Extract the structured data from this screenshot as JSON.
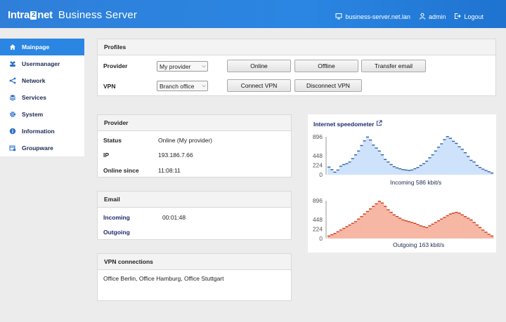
{
  "header": {
    "brand_left": "Intra",
    "brand_box": "2",
    "brand_right": "net",
    "product": "Business Server",
    "host": "business-server.net.lan",
    "user": "admin",
    "logout": "Logout"
  },
  "sidebar": {
    "items": [
      {
        "label": "Mainpage",
        "icon": "home-icon"
      },
      {
        "label": "Usermanager",
        "icon": "users-icon"
      },
      {
        "label": "Network",
        "icon": "share-icon"
      },
      {
        "label": "Services",
        "icon": "layers-icon"
      },
      {
        "label": "System",
        "icon": "gear-icon"
      },
      {
        "label": "Information",
        "icon": "info-icon"
      },
      {
        "label": "Groupware",
        "icon": "groupware-icon"
      }
    ]
  },
  "profiles": {
    "title": "Profiles",
    "provider_label": "Provider",
    "provider_value": "My provider",
    "vpn_label": "VPN",
    "vpn_value": "Branch office",
    "btn_online": "Online",
    "btn_offline": "Offline",
    "btn_transfer": "Transfer email",
    "btn_connect": "Connect VPN",
    "btn_disconnect": "Disconnect VPN"
  },
  "provider": {
    "title": "Provider",
    "status_label": "Status",
    "status_value": "Online (My provider)",
    "ip_label": "IP",
    "ip_value": "193.186.7.66",
    "since_label": "Online since",
    "since_value": "11:08:11"
  },
  "email": {
    "title": "Email",
    "incoming_label": "Incoming",
    "incoming_value": "00:01:48",
    "outgoing_label": "Outgoing",
    "outgoing_value": ""
  },
  "vpn": {
    "title": "VPN connections",
    "value": "Office Berlin, Office Hamburg, Office Stuttgart"
  },
  "speedometer": {
    "title": "Internet speedometer",
    "incoming_caption": "Incoming 586 kbit/s",
    "outgoing_caption": "Outgoing 163 kbit/s"
  },
  "colors": {
    "accent": "#2a86e2",
    "incoming_fill": "#cfe2fb",
    "incoming_line": "#2f63a8",
    "outgoing_fill": "#f6b7a4",
    "outgoing_line": "#d23a1e"
  },
  "chart_data": [
    {
      "type": "area",
      "ylim": [
        0,
        896
      ],
      "yticks": [
        896,
        448,
        224,
        0
      ],
      "caption": "Incoming 586 kbit/s",
      "values": [
        180,
        120,
        60,
        110,
        200,
        240,
        260,
        300,
        380,
        470,
        560,
        690,
        800,
        890,
        820,
        700,
        630,
        560,
        470,
        360,
        300,
        240,
        190,
        160,
        140,
        120,
        110,
        100,
        110,
        140,
        170,
        220,
        260,
        320,
        400,
        470,
        560,
        650,
        730,
        830,
        900,
        860,
        790,
        740,
        660,
        600,
        520,
        430,
        340,
        300,
        220,
        170,
        130,
        100,
        70,
        40
      ]
    },
    {
      "type": "area",
      "ylim": [
        0,
        896
      ],
      "yticks": [
        896,
        448,
        224,
        0
      ],
      "caption": "Outgoing 163 kbit/s",
      "values": [
        60,
        90,
        120,
        160,
        200,
        240,
        280,
        320,
        360,
        400,
        460,
        520,
        580,
        640,
        700,
        760,
        820,
        880,
        840,
        760,
        680,
        620,
        560,
        520,
        480,
        440,
        420,
        400,
        380,
        360,
        330,
        300,
        280,
        260,
        300,
        340,
        380,
        420,
        460,
        500,
        540,
        580,
        600,
        620,
        600,
        560,
        520,
        480,
        440,
        380,
        320,
        260,
        200,
        150,
        100,
        60
      ]
    }
  ]
}
